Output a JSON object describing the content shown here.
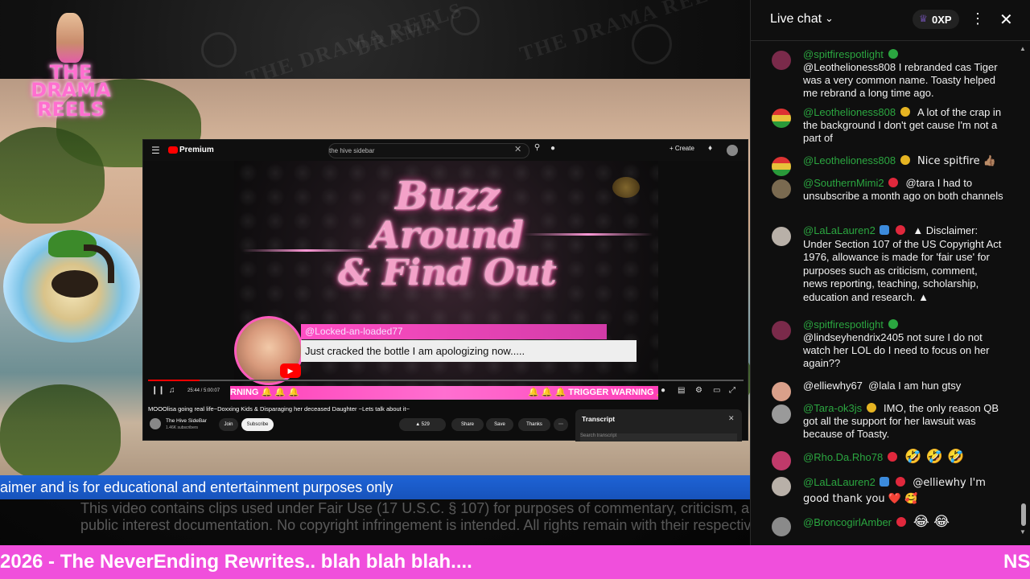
{
  "branding": {
    "logo_line1": "THE",
    "logo_line2": "DRAMA",
    "logo_line3": "REELS"
  },
  "embedded_youtube": {
    "logo": "Premium",
    "search_query": "the hive sidebar",
    "create_label": "+ Create",
    "video_title_l1": "Buzz",
    "video_title_l2": "Around",
    "video_title_l3": "& Find Out",
    "overlay_handle": "@Locked-an-loaded77",
    "overlay_message": "Just cracked the bottle I am apologizing now.....",
    "trigger_left": "RNING 🔔 🔔 🔔",
    "trigger_right": "🔔 🔔 🔔 TRIGGER WARNING 🔔",
    "time_display": "25:44 / 5:00:07",
    "progress_fraction": 0.086,
    "page_title": "MOOOlisa going real life~Doxxing Kids & Disparaging her deceased Daughter ~Lets talk about it~",
    "channel_name": "The Hive SideBar",
    "channel_subs": "1.46K subscribers",
    "join_label": "Join",
    "subscribe_label": "Subscribe",
    "likes": "529",
    "share_label": "Share",
    "save_label": "Save",
    "thanks_label": "Thanks",
    "transcript_title": "Transcript",
    "transcript_search": "Search transcript"
  },
  "lower_third": "aimer and is for educational and entertainment purposes only",
  "fair_use_line1": "This video contains clips used under Fair Use (17 U.S.C. § 107) for purposes of commentary, criticism, and",
  "fair_use_line2": "public interest documentation. No copyright infringement is intended. All rights remain with their respective",
  "ticker": {
    "text": "2026 - The NeverEnding Rewrites.. blah blah blah....",
    "right": "NS"
  },
  "chat": {
    "title": "Live chat",
    "xp": "0XP",
    "colors": {
      "name": "#2ba640",
      "text": "#f1f1f1",
      "background": "#0f0f0f"
    },
    "messages": [
      {
        "name": "@spitfirespotlight",
        "text": "@Leothelioness808 I rebranded cas Tiger was a very common name. Toasty helped me rebrand a long time ago."
      },
      {
        "name": "@Leothelioness808",
        "text": "A lot of the crap in the background I don't get cause I'm not a part of"
      },
      {
        "name": "@Leothelioness808",
        "text": "Nice spitfire 👍🏽"
      },
      {
        "name": "@SouthernMimi2",
        "text": "@tara I had to unsubscribe a month ago on both channels"
      },
      {
        "name": "@LaLaLauren2",
        "text": "▲ Disclaimer: Under Section 107 of the US Copyright Act 1976, allowance is made for 'fair use' for purposes such as criticism, comment, news reporting, teaching, scholarship, education and research. ▲"
      },
      {
        "name": "@spitfirespotlight",
        "text": "@lindseyhendrix2405 not sure I do not watch her LOL do I need to focus on her again??"
      },
      {
        "name": "@elliewhy67",
        "text": "@lala I am hun gtsy"
      },
      {
        "name": "@Tara-ok3js",
        "text": "IMO, the only reason QB got all the support for her lawsuit was because of Toasty."
      },
      {
        "name": "@Rho.Da.Rho78",
        "text": "🤣 🤣 🤣"
      },
      {
        "name": "@LaLaLauren2",
        "text": "@elliewhy I'm good thank you ❤️ 🥰"
      },
      {
        "name": "@BroncogirlAmber",
        "text": "😂 😂"
      }
    ]
  }
}
